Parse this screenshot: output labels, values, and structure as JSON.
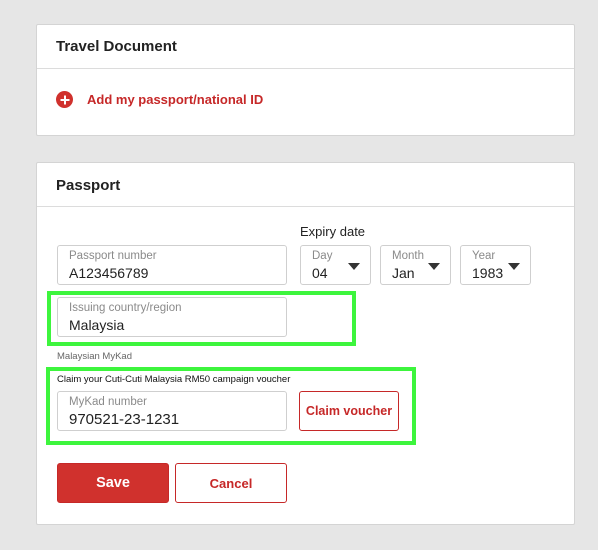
{
  "travel_document": {
    "title": "Travel Document",
    "add_label": "Add my passport/national ID"
  },
  "passport": {
    "title": "Passport",
    "passport_number": {
      "label": "Passport number",
      "value": "A123456789"
    },
    "expiry": {
      "title": "Expiry date",
      "day": {
        "label": "Day",
        "value": "04"
      },
      "month": {
        "label": "Month",
        "value": "Jan"
      },
      "year": {
        "label": "Year",
        "value": "1983"
      }
    },
    "issuing_country": {
      "label": "Issuing country/region",
      "value": "Malaysia"
    },
    "mykad_section_label": "Malaysian MyKad",
    "campaign_note": "Claim your Cuti-Cuti Malaysia RM50 campaign voucher",
    "mykad": {
      "label": "MyKad number",
      "value": "970521-23-1231"
    },
    "claim_button": "Claim voucher",
    "save_button": "Save",
    "cancel_button": "Cancel"
  },
  "colors": {
    "accent": "#d0312d",
    "highlight": "#3df53d",
    "background": "#e6e6e6"
  }
}
